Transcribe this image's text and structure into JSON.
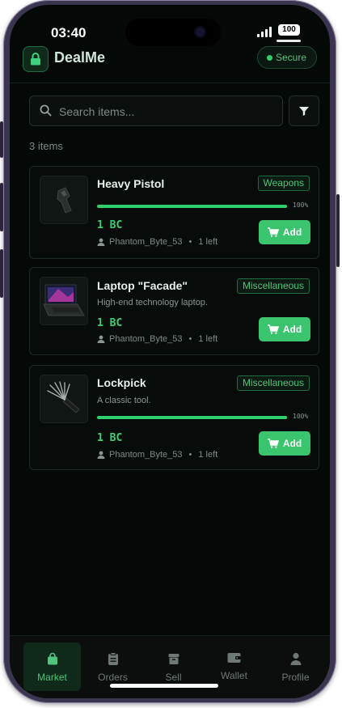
{
  "status": {
    "time": "03:40",
    "battery": "100"
  },
  "header": {
    "brand": "DealMe",
    "secure_label": "Secure"
  },
  "search": {
    "placeholder": "Search items..."
  },
  "results": {
    "count_text": "3 items"
  },
  "items": [
    {
      "name": "Heavy Pistol",
      "category": "Weapons",
      "description": "",
      "progress": 100,
      "progress_text": "100%",
      "price": "1 BC",
      "seller": "Phantom_Byte_53",
      "stock": "1 left",
      "add_label": "Add"
    },
    {
      "name": "Laptop \"Facade\"",
      "category": "Miscellaneous",
      "description": "High-end technology laptop.",
      "progress": null,
      "progress_text": "",
      "price": "1 BC",
      "seller": "Phantom_Byte_53",
      "stock": "1 left",
      "add_label": "Add"
    },
    {
      "name": "Lockpick",
      "category": "Miscellaneous",
      "description": "A classic tool.",
      "progress": 100,
      "progress_text": "100%",
      "price": "1 BC",
      "seller": "Phantom_Byte_53",
      "stock": "1 left",
      "add_label": "Add"
    }
  ],
  "tabs": [
    {
      "label": "Market",
      "icon": "bag-icon",
      "active": true
    },
    {
      "label": "Orders",
      "icon": "clipboard-icon",
      "active": false
    },
    {
      "label": "Sell",
      "icon": "box-icon",
      "active": false
    },
    {
      "label": "Wallet",
      "icon": "wallet-icon",
      "active": false
    },
    {
      "label": "Profile",
      "icon": "user-icon",
      "active": false
    }
  ],
  "colors": {
    "accent": "#3ac46d",
    "background": "#040807",
    "text": "#e6efe9"
  }
}
